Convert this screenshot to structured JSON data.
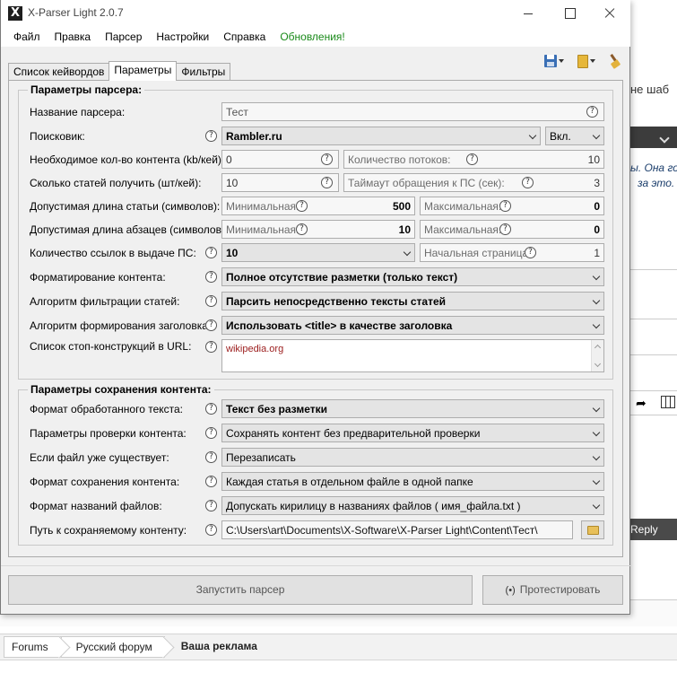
{
  "window": {
    "title": "X-Parser Light 2.0.7"
  },
  "menu": [
    "Файл",
    "Правка",
    "Парсер",
    "Настройки",
    "Справка",
    "Обновления!"
  ],
  "tabs": [
    "Список кейвордов",
    "Параметры",
    "Фильтры"
  ],
  "toolbar_icons": [
    "save-icon",
    "folder-icon",
    "broom-icon"
  ],
  "parser_group": {
    "title": "Параметры парсера:",
    "name_label": "Название парсера:",
    "name_value": "Тест",
    "engine_label": "Поисковик:",
    "engine_value": "Rambler.ru",
    "engine_state": "Вкл.",
    "content_label": "Необходимое кол-во контента (kb/кей):",
    "content_value": "0",
    "threads_label": "Количество потоков:",
    "threads_value": "10",
    "articles_label": "Сколько статей получить (шт/кей):",
    "articles_value": "10",
    "timeout_label": "Таймаут обращения к ПС (сек):",
    "timeout_value": "3",
    "article_len_label": "Допустимая длина статьи (символов):",
    "article_min_label": "Минимальная:",
    "article_min_value": "500",
    "article_max_label": "Максимальная:",
    "article_max_value": "0",
    "para_len_label": "Допустимая длина абзацев (символов):",
    "para_min_label": "Минимальная:",
    "para_min_value": "10",
    "para_max_label": "Максимальная:",
    "para_max_value": "0",
    "links_label": "Количество ссылок в выдаче ПС:",
    "links_value": "10",
    "start_page_label": "Начальная страница:",
    "start_page_value": "1",
    "format_label": "Форматирование контента:",
    "format_value": "Полное отсутствие разметки (только текст)",
    "filter_label": "Алгоритм фильтрации статей:",
    "filter_value": "Парсить непосредственно тексты статей",
    "heading_label": "Алгоритм формирования заголовка:",
    "heading_value": "Использовать <title> в качестве заголовка",
    "stop_label": "Список стоп-конструкций в URL:",
    "stop_value": "wikipedia.org"
  },
  "save_group": {
    "title": "Параметры сохранения контента:",
    "text_format_label": "Формат обработанного текста:",
    "text_format_value": "Текст без разметки",
    "check_label": "Параметры проверки контента:",
    "check_value": "Сохранять контент без предварительной проверки",
    "exists_label": "Если файл уже существует:",
    "exists_value": "Перезаписать",
    "save_format_label": "Формат сохранения контента:",
    "save_format_value": "Каждая статья в отдельном файле в одной папке",
    "filenames_label": "Формат названий файлов:",
    "filenames_value": "Допускать кирилицу в названиях файлов ( имя_файла.txt )",
    "path_label": "Путь к сохраняемому контенту:",
    "path_value": "C:\\Users\\art\\Documents\\X-Software\\X-Parser Light\\Content\\Тест\\"
  },
  "buttons": {
    "run": "Запустить парсер",
    "test": "Протестировать",
    "test_icon": "(•)"
  },
  "help_glyph": "?",
  "background": {
    "text1": "не шаб",
    "italic1": "ы. Она го",
    "italic2": "за это.",
    "reply": "Reply",
    "breadcrumbs": [
      "Forums",
      "Русский форум",
      "Ваша реклама"
    ]
  }
}
